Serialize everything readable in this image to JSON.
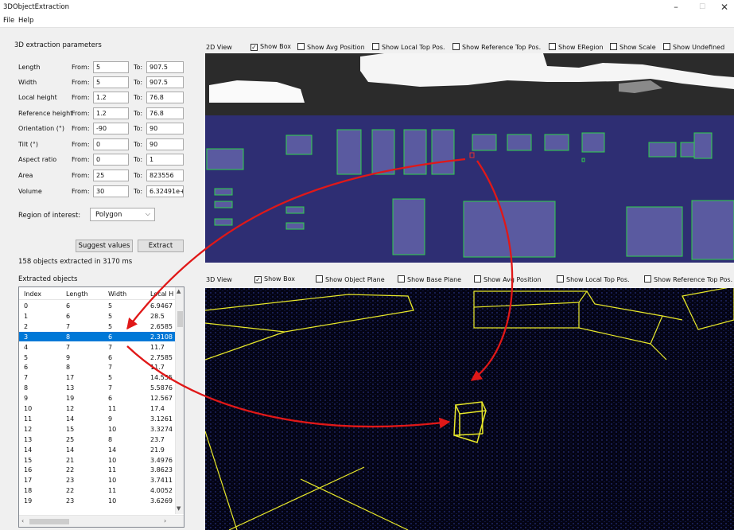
{
  "window": {
    "title": "3DObjectExtraction",
    "minimize": "–",
    "maximize": "☐",
    "close": "✕"
  },
  "menu": {
    "file": "File",
    "help": "Help"
  },
  "params": {
    "group_title": "3D extraction parameters",
    "from_label": "From:",
    "to_label": "To:",
    "rows": [
      {
        "label": "Length",
        "from": "5",
        "to": "907.5"
      },
      {
        "label": "Width",
        "from": "5",
        "to": "907.5"
      },
      {
        "label": "Local height",
        "from": "1.2",
        "to": "76.8"
      },
      {
        "label": "Reference height",
        "from": "1.2",
        "to": "76.8"
      },
      {
        "label": "Orientation (°)",
        "from": "-90",
        "to": "90"
      },
      {
        "label": "Tilt (°)",
        "from": "0",
        "to": "90"
      },
      {
        "label": "Aspect ratio",
        "from": "0",
        "to": "1"
      },
      {
        "label": "Area",
        "from": "25",
        "to": "823556"
      },
      {
        "label": "Volume",
        "from": "30",
        "to": "6.32491e+"
      }
    ],
    "roi_label": "Region of interest:",
    "roi_value": "Polygon",
    "suggest_button": "Suggest values",
    "extract_button": "Extract",
    "status": "158 objects extracted in 3170 ms"
  },
  "objects": {
    "title": "Extracted objects",
    "columns": [
      "Index",
      "Length",
      "Width",
      "Local H"
    ],
    "selected_index": 3,
    "rows": [
      [
        "0",
        "6",
        "5",
        "6.9467"
      ],
      [
        "1",
        "6",
        "5",
        "28.5"
      ],
      [
        "2",
        "7",
        "5",
        "2.6585"
      ],
      [
        "3",
        "8",
        "6",
        "2.3108"
      ],
      [
        "4",
        "7",
        "7",
        "11.7"
      ],
      [
        "5",
        "9",
        "6",
        "2.7585"
      ],
      [
        "6",
        "8",
        "7",
        "11.7"
      ],
      [
        "7",
        "17",
        "5",
        "14.555"
      ],
      [
        "8",
        "13",
        "7",
        "5.5876"
      ],
      [
        "9",
        "19",
        "6",
        "12.567"
      ],
      [
        "10",
        "12",
        "11",
        "17.4"
      ],
      [
        "11",
        "14",
        "9",
        "3.1261"
      ],
      [
        "12",
        "15",
        "10",
        "3.3274"
      ],
      [
        "13",
        "25",
        "8",
        "23.7"
      ],
      [
        "14",
        "14",
        "14",
        "21.9"
      ],
      [
        "15",
        "21",
        "10",
        "3.4976"
      ],
      [
        "16",
        "22",
        "11",
        "3.8623"
      ],
      [
        "17",
        "23",
        "10",
        "3.7411"
      ],
      [
        "18",
        "22",
        "11",
        "4.0052"
      ],
      [
        "19",
        "23",
        "10",
        "3.6269"
      ]
    ]
  },
  "view2d": {
    "label": "2D View",
    "options": [
      {
        "label": "Show Box",
        "checked": true
      },
      {
        "label": "Show Avg Position",
        "checked": false
      },
      {
        "label": "Show Local Top Pos.",
        "checked": false
      },
      {
        "label": "Show Reference Top Pos.",
        "checked": false
      },
      {
        "label": "Show ERegion",
        "checked": false
      },
      {
        "label": "Show Scale",
        "checked": false
      },
      {
        "label": "Show Undefined",
        "checked": false
      }
    ]
  },
  "view3d": {
    "label": "3D View",
    "options": [
      {
        "label": "Show Box",
        "checked": true
      },
      {
        "label": "Show Object Plane",
        "checked": false
      },
      {
        "label": "Show Base Plane",
        "checked": false
      },
      {
        "label": "Show Avg Position",
        "checked": false
      },
      {
        "label": "Show Local Top Pos.",
        "checked": false
      },
      {
        "label": "Show Reference Top Pos.",
        "checked": false
      }
    ]
  },
  "colors": {
    "selection": "#0078d7",
    "board_2d": "#2e2e73",
    "box_outline_2d": "#2fd34a",
    "box_outline_3d": "#e8e82a",
    "annotation_arrow": "#e01818"
  }
}
